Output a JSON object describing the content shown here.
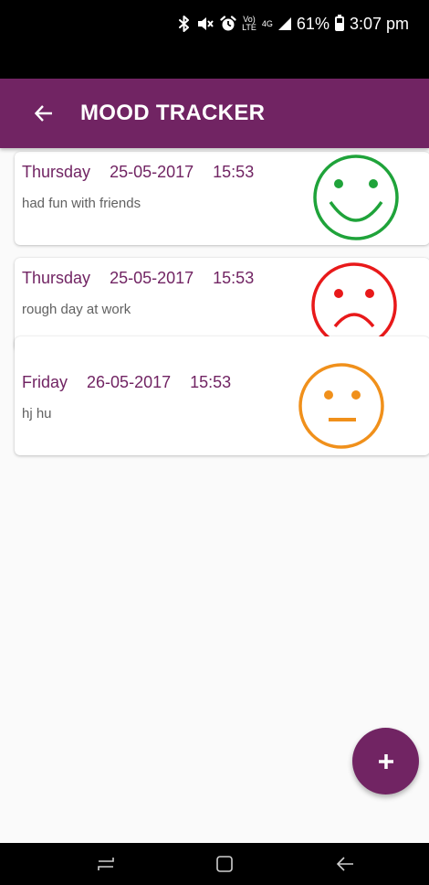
{
  "status_bar": {
    "volte_top": "Vo)",
    "volte_bottom": "LTE",
    "network_type": "4G",
    "battery_percent": "61%",
    "battery_level": 0.61,
    "time": "3:07 pm"
  },
  "app_bar": {
    "title": "MOOD TRACKER"
  },
  "entries": [
    {
      "day": "Thursday",
      "date": "25-05-2017",
      "time": "15:53",
      "note": "had fun with friends",
      "mood": "happy",
      "color": "#1fa33a"
    },
    {
      "day": "Thursday",
      "date": "25-05-2017",
      "time": "15:53",
      "note": "rough day at work",
      "mood": "sad",
      "color": "#e8191a"
    },
    {
      "day": "Friday",
      "date": "26-05-2017",
      "time": "15:53",
      "note": "hj hu",
      "mood": "neutral",
      "color": "#f0901b"
    }
  ],
  "fab": {
    "icon": "plus-icon"
  },
  "colors": {
    "primary": "#712463",
    "background": "#fafafa"
  }
}
